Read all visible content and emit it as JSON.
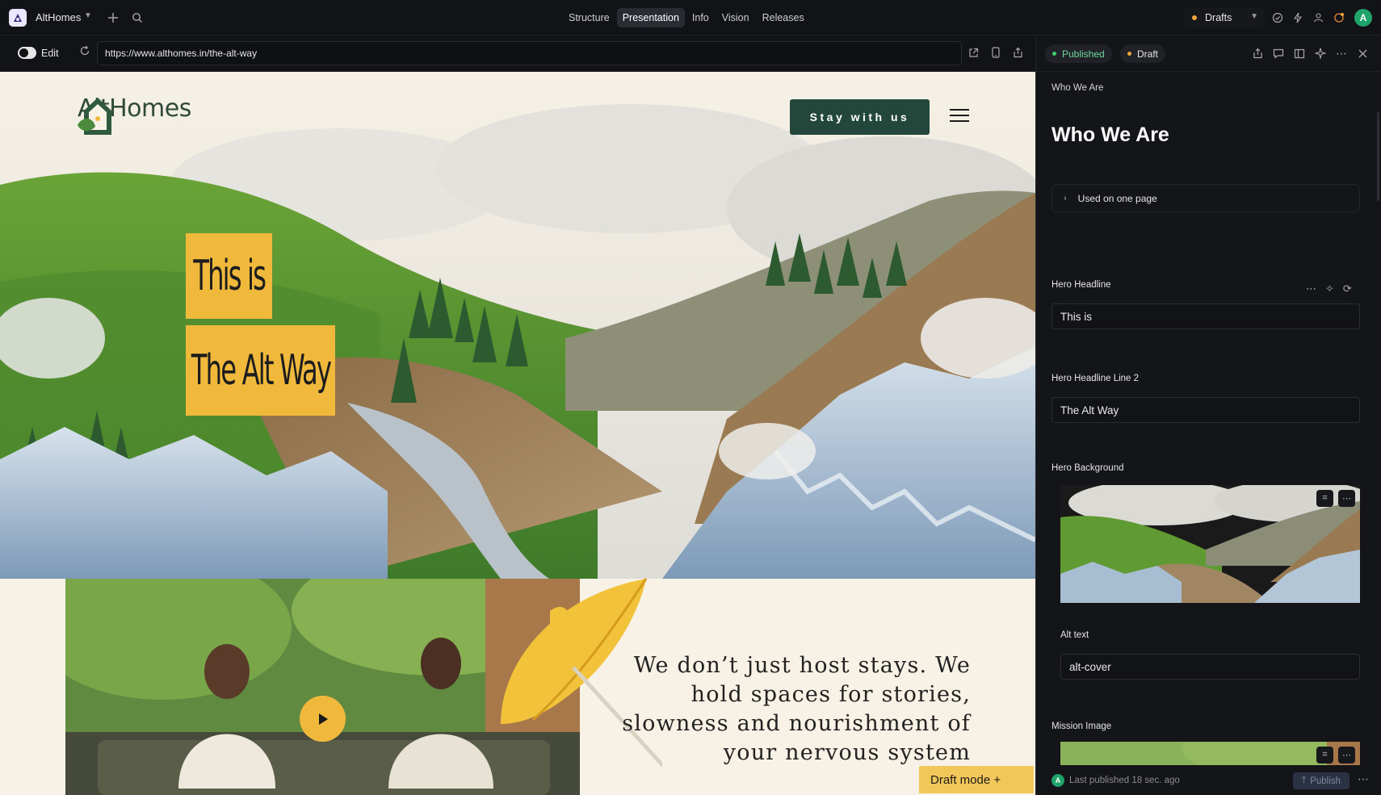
{
  "app": {
    "name": "AltHomes",
    "tabs": [
      {
        "label": "Structure"
      },
      {
        "label": "Presentation"
      },
      {
        "label": "Info"
      },
      {
        "label": "Vision"
      },
      {
        "label": "Releases"
      }
    ],
    "active_tab": "Presentation",
    "environment": "Drafts",
    "user_initial": "A",
    "icons": [
      "app-logo-icon",
      "chevron-down-icon",
      "plus-icon",
      "search-icon",
      "check-circle-icon",
      "bolt-icon",
      "users-icon",
      "refresh-badge-icon",
      "avatar"
    ]
  },
  "toolbar": {
    "edit_label": "Edit",
    "url": "https://www.althomes.in/the-alt-way",
    "icons": [
      "reload-icon",
      "external-link-icon",
      "mobile-icon",
      "share-icon"
    ]
  },
  "site": {
    "brand": "AltHomes",
    "cta": "Stay with us",
    "headline_1": "This is",
    "headline_2": "The Alt Way",
    "mission": "We don’t just host stays. We hold spaces for stories, slowness and nourishment of your nervous system",
    "draft_mode": "Draft mode +",
    "colors": {
      "accent_yellow": "#f1b93c",
      "brand_green": "#23473a",
      "cream": "#f8f1e5"
    }
  },
  "panel": {
    "published_label": "Published",
    "draft_label": "Draft",
    "breadcrumb": "Who We Are",
    "title": "Who We Are",
    "used_on": "Used on one page",
    "fields": {
      "hero_headline_label": "Hero Headline",
      "hero_headline_value": "This is",
      "hero_headline_2_label": "Hero Headline Line 2",
      "hero_headline_2_value": "The Alt Way",
      "hero_background_label": "Hero Background",
      "alt_text_label": "Alt text",
      "alt_text_value": "alt-cover",
      "mission_image_label": "Mission Image"
    },
    "footer": {
      "avatar_initial": "A",
      "last_published": "Last published 18 sec. ago",
      "publish_label": "Publish"
    },
    "colors": {
      "published_dot": "#3ecf6e",
      "draft_dot": "#f0a53a"
    }
  }
}
